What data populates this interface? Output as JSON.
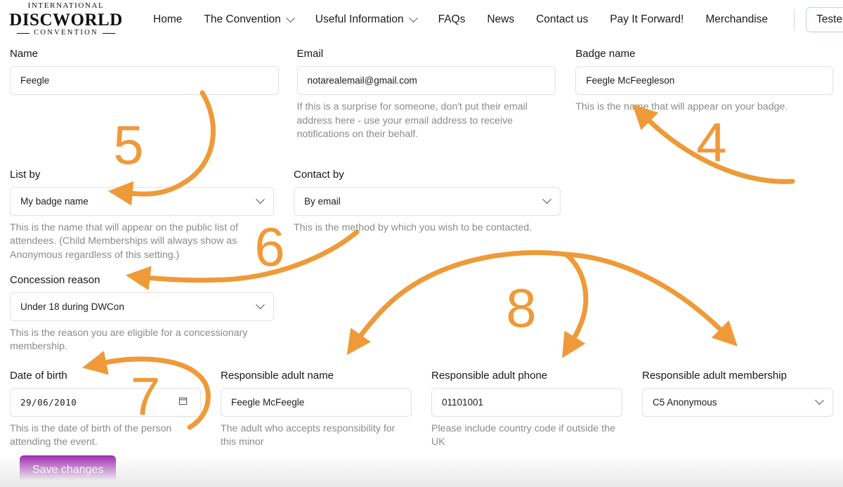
{
  "header": {
    "logo": {
      "line1": "INTERNATIONAL",
      "line2": "DISCWORLD",
      "line3": "CONVENTION"
    },
    "nav": [
      {
        "label": "Home",
        "has_chevron": false
      },
      {
        "label": "The Convention",
        "has_chevron": true
      },
      {
        "label": "Useful Information",
        "has_chevron": true
      },
      {
        "label": "FAQs",
        "has_chevron": false
      },
      {
        "label": "News",
        "has_chevron": false
      },
      {
        "label": "Contact us",
        "has_chevron": false
      },
      {
        "label": "Pay It Forward!",
        "has_chevron": false
      },
      {
        "label": "Merchandise",
        "has_chevron": false
      }
    ],
    "user_menu": {
      "label": "Tester"
    }
  },
  "form": {
    "name": {
      "label": "Name",
      "value": "Feegle",
      "help": ""
    },
    "email": {
      "label": "Email",
      "value": "notarealemail@gmail.com",
      "help": "If this is a surprise for someone, don't put their email address here - use your email address to receive notifications on their behalf."
    },
    "badge_name": {
      "label": "Badge name",
      "value": "Feegle McFeegleson",
      "help": "This is the name that will appear on your badge."
    },
    "list_by": {
      "label": "List by",
      "value": "My badge name",
      "help": "This is the name that will appear on the public list of attendees. (Child Memberships will always show as Anonymous regardless of this setting.)"
    },
    "contact_by": {
      "label": "Contact by",
      "value": "By email",
      "help": "This is the method by which you wish to be contacted."
    },
    "concession_reason": {
      "label": "Concession reason",
      "value": "Under 18 during DWCon",
      "help": "This is the reason you are eligible for a concessionary membership."
    },
    "date_of_birth": {
      "label": "Date of birth",
      "value": "29/06/2010",
      "help": "This is the date of birth of the person attending the event."
    },
    "responsible_adult_name": {
      "label": "Responsible adult name",
      "value": "Feegle McFeegle",
      "help": "The adult who accepts responsibility for this minor"
    },
    "responsible_adult_phone": {
      "label": "Responsible adult phone",
      "value": "01101001",
      "help": "Please include country code if outside the UK"
    },
    "responsible_adult_membership": {
      "label": "Responsible adult membership",
      "value": "C5 Anonymous",
      "help": ""
    },
    "save_button": {
      "label": "Save changes"
    }
  },
  "annotations": {
    "color": "#ef9a38",
    "steps": [
      {
        "number": "4",
        "points_to": "badge-name-input"
      },
      {
        "number": "5",
        "points_to": "list-by-select"
      },
      {
        "number": "6",
        "points_to": "concession-reason-label"
      },
      {
        "number": "7",
        "points_to": "date-of-birth-label"
      },
      {
        "number": "8",
        "points_to": "responsible-adult-fields"
      }
    ]
  },
  "colors": {
    "accent_orange": "#ef9a38",
    "save_purple": "#9c27b0",
    "user_button_border": "#b9d5d9",
    "input_border": "#e2e2e2",
    "help_text": "#8b8b8b"
  }
}
